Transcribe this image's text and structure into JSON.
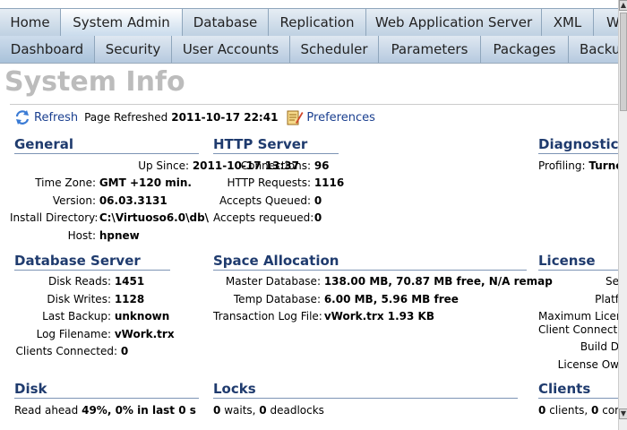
{
  "tabs_primary": [
    {
      "label": "Home",
      "active": false
    },
    {
      "label": "System Admin",
      "active": true
    },
    {
      "label": "Database",
      "active": false
    },
    {
      "label": "Replication",
      "active": false
    },
    {
      "label": "Web Application Server",
      "active": false
    },
    {
      "label": "XML",
      "active": false
    },
    {
      "label": "W",
      "active": false
    }
  ],
  "tabs_secondary": [
    {
      "label": "Dashboard",
      "active": true
    },
    {
      "label": "Security",
      "active": false
    },
    {
      "label": "User Accounts",
      "active": false
    },
    {
      "label": "Scheduler",
      "active": false
    },
    {
      "label": "Parameters",
      "active": false
    },
    {
      "label": "Packages",
      "active": false
    },
    {
      "label": "Backu",
      "active": false
    }
  ],
  "page_title": "System Info",
  "toolbar": {
    "refresh_label": "Refresh",
    "page_refreshed_label": "Page Refreshed",
    "page_refreshed_value": "2011-10-17 22:41",
    "preferences_label": "Preferences"
  },
  "sections": {
    "general": {
      "title": "General",
      "rows": [
        {
          "label": "Up Since:",
          "value": "2011-10-17 13:37"
        },
        {
          "label": "Time Zone:",
          "value": "GMT +120 min."
        },
        {
          "label": "Version:",
          "value": "06.03.3131"
        },
        {
          "label": "Install Directory:",
          "value": "C:\\Virtuoso6.0\\db\\"
        },
        {
          "label": "Host:",
          "value": "hpnew"
        }
      ]
    },
    "http_server": {
      "title": "HTTP Server",
      "rows": [
        {
          "label": "Connections:",
          "value": "96"
        },
        {
          "label": "HTTP Requests:",
          "value": "1116"
        },
        {
          "label": "Accepts Queued:",
          "value": "0"
        },
        {
          "label": "Accepts requeued:",
          "value": "0"
        }
      ]
    },
    "diagnostics": {
      "title": "Diagnostic",
      "rows": [
        {
          "label": "Profiling:",
          "value": "Turne"
        }
      ]
    },
    "database_server": {
      "title": "Database Server",
      "rows": [
        {
          "label": "Disk Reads:",
          "value": "1451"
        },
        {
          "label": "Disk Writes:",
          "value": "1128"
        },
        {
          "label": "Last Backup:",
          "value": "unknown"
        },
        {
          "label": "Log Filename:",
          "value": "vWork.trx"
        },
        {
          "label": "Clients Connected:",
          "value": "0"
        }
      ]
    },
    "space_allocation": {
      "title": "Space Allocation",
      "rows": [
        {
          "label": "Master Database:",
          "value": "138.00 MB, 70.87 MB free, N/A remap"
        },
        {
          "label": "Temp Database:",
          "value": "6.00 MB, 5.96 MB free"
        },
        {
          "label": "Transaction Log File:",
          "value": "vWork.trx 1.93 KB"
        }
      ]
    },
    "license": {
      "title": "License",
      "rows": [
        {
          "label": "Se",
          "value": ""
        },
        {
          "label": "Platf",
          "value": ""
        },
        {
          "label": "Maximum Licen",
          "value": ""
        },
        {
          "label": "Client Connecti",
          "value": ""
        },
        {
          "label": "Build D",
          "value": ""
        },
        {
          "label": "License Ow",
          "value": ""
        }
      ]
    },
    "disk": {
      "title": "Disk",
      "row": {
        "label": "Read ahead",
        "value": "49%, 0% in last 0 s"
      }
    },
    "locks": {
      "title": "Locks",
      "row": {
        "v1": "0",
        "t1": "waits,",
        "v2": "0",
        "t2": "deadlocks"
      }
    },
    "clients": {
      "title": "Clients",
      "row": {
        "v1": "0",
        "t1": "clients,",
        "v2": "0",
        "t2": "conn"
      }
    }
  },
  "colors": {
    "accent": "#1f3b6e",
    "link": "#1a3f8f",
    "title_gray": "#bcbcbc"
  }
}
